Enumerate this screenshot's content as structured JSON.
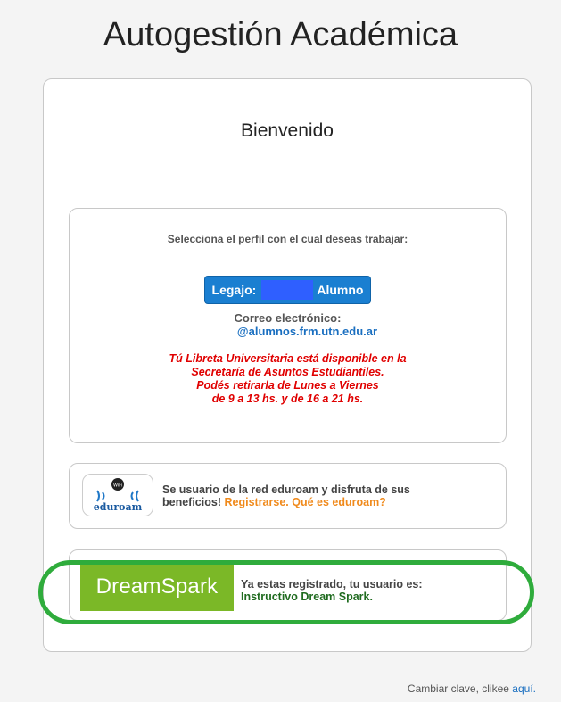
{
  "page": {
    "title": "Autogestión Académica"
  },
  "welcome": "Bienvenido",
  "profile": {
    "select_text": "Selecciona el perfil con el cual deseas trabajar:",
    "legajo_label": "Legajo:",
    "role": "Alumno",
    "email_label": "Correo electrónico:",
    "email_value": "@alumnos.frm.utn.edu.ar",
    "notice_lines": [
      "Tú Libreta Universitaria está disponible en la",
      "Secretaría de Asuntos Estudiantiles.",
      "Podés retirarla de Lunes a Viernes",
      "de 9 a 13 hs. y de 16 a 21 hs."
    ]
  },
  "eduroam": {
    "logo_text": "eduroam",
    "text_line1": "Se usuario de la red eduroam y disfruta de sus",
    "text_line2": "beneficios!",
    "register_link": "Registrarse.",
    "what_link": "Qué es eduroam?"
  },
  "dreamspark": {
    "logo_text": "DreamSpark",
    "registered_text": "Ya estas registrado, tu usuario es:",
    "instructive_link": "Instructivo Dream Spark."
  },
  "footer": {
    "text": "Cambiar clave, clikee",
    "link": "aquí."
  },
  "colors": {
    "accent": "#1a7fd1",
    "notice": "#e00000",
    "dreamspark": "#7bb827",
    "highlight": "#2fac3c"
  }
}
